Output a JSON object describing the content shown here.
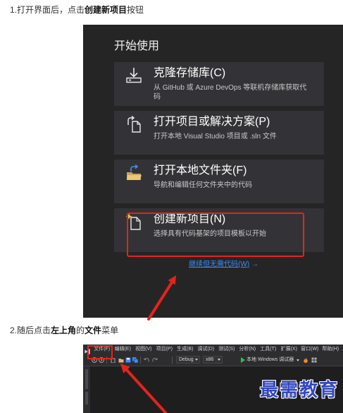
{
  "steps": [
    {
      "segments": [
        {
          "text": "1.打开界面后，点击",
          "bold": false
        },
        {
          "text": "创建新项目",
          "bold": true
        },
        {
          "text": "按钮",
          "bold": false
        }
      ]
    },
    {
      "segments": [
        {
          "text": "2.随后点击",
          "bold": false
        },
        {
          "text": "左上角",
          "bold": true
        },
        {
          "text": "的",
          "bold": false
        },
        {
          "text": "文件",
          "bold": true
        },
        {
          "text": "菜单",
          "bold": false
        }
      ]
    }
  ],
  "start_window": {
    "heading": "开始使用",
    "cards": [
      {
        "title": "克隆存储库(C)",
        "description": "从 GitHub 或 Azure DevOps 等联机存储库获取代码",
        "icon": "clone-repository-icon",
        "highlighted": false
      },
      {
        "title": "打开项目或解决方案(P)",
        "description": "打开本地 Visual Studio 项目或 .sln 文件",
        "icon": "open-project-icon",
        "highlighted": false
      },
      {
        "title": "打开本地文件夹(F)",
        "description": "导航和编辑任何文件夹中的代码",
        "icon": "open-folder-icon",
        "highlighted": false
      },
      {
        "title": "创建新项目(N)",
        "description": "选择具有代码基架的项目模板以开始",
        "icon": "new-project-icon",
        "highlighted": true
      }
    ],
    "continue_link": "继续但无需代码(W)",
    "continue_arrow": "→"
  },
  "ide": {
    "menu": [
      {
        "label": "文件(F)",
        "highlighted": true
      },
      {
        "label": "编辑(E)",
        "highlighted": false
      },
      {
        "label": "视图(V)",
        "highlighted": false
      },
      {
        "label": "项目(P)",
        "highlighted": false
      },
      {
        "label": "生成(B)",
        "highlighted": false
      },
      {
        "label": "调试(D)",
        "highlighted": false
      },
      {
        "label": "测试(S)",
        "highlighted": false
      },
      {
        "label": "分析(N)",
        "highlighted": false
      },
      {
        "label": "工具(T)",
        "highlighted": false
      },
      {
        "label": "扩展(X)",
        "highlighted": false
      },
      {
        "label": "窗口(W)",
        "highlighted": false
      },
      {
        "label": "帮助(H)",
        "highlighted": false
      }
    ],
    "toolbar": {
      "configuration": "Debug",
      "platform": "x86",
      "run_target": "本地 Windows 调试器"
    }
  },
  "watermark": "最需教育",
  "colors": {
    "annotation_red": "#e3241b",
    "link_blue": "#3e8ef7",
    "start_window_bg": "#252526",
    "card_bg": "#333337",
    "ide_chrome_bg": "#2d2d30",
    "watermark_blue": "#3348c0"
  }
}
